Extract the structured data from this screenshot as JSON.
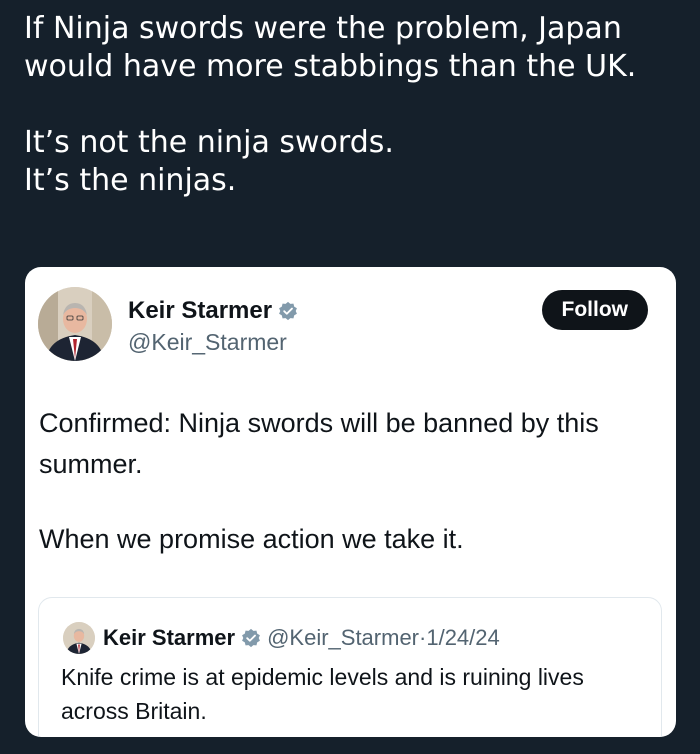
{
  "post": {
    "line1": "If Ninja swords were the problem, Japan would have more stabbings than the UK.",
    "line2": "It’s not the ninja swords.",
    "line3": "It’s the ninjas."
  },
  "tweet": {
    "name": "Keir Starmer",
    "handle": "@Keir_Starmer",
    "follow_label": "Follow",
    "paragraph1": "Confirmed: Ninja swords will be banned by this summer.",
    "paragraph2": "When we promise action we take it.",
    "avatar_icon": "person-avatar",
    "verified_icon": "verified-badge",
    "verified_color": "#829aab"
  },
  "quoted": {
    "name": "Keir Starmer",
    "handle": "@Keir_Starmer",
    "separator": "·",
    "date": "1/24/24",
    "text": "Knife crime is at epidemic levels and is ruining lives across Britain."
  },
  "colors": {
    "background": "#15202b",
    "card": "#ffffff",
    "text_primary": "#0f1419",
    "text_secondary": "#536471",
    "follow_button": "#0f1419"
  }
}
